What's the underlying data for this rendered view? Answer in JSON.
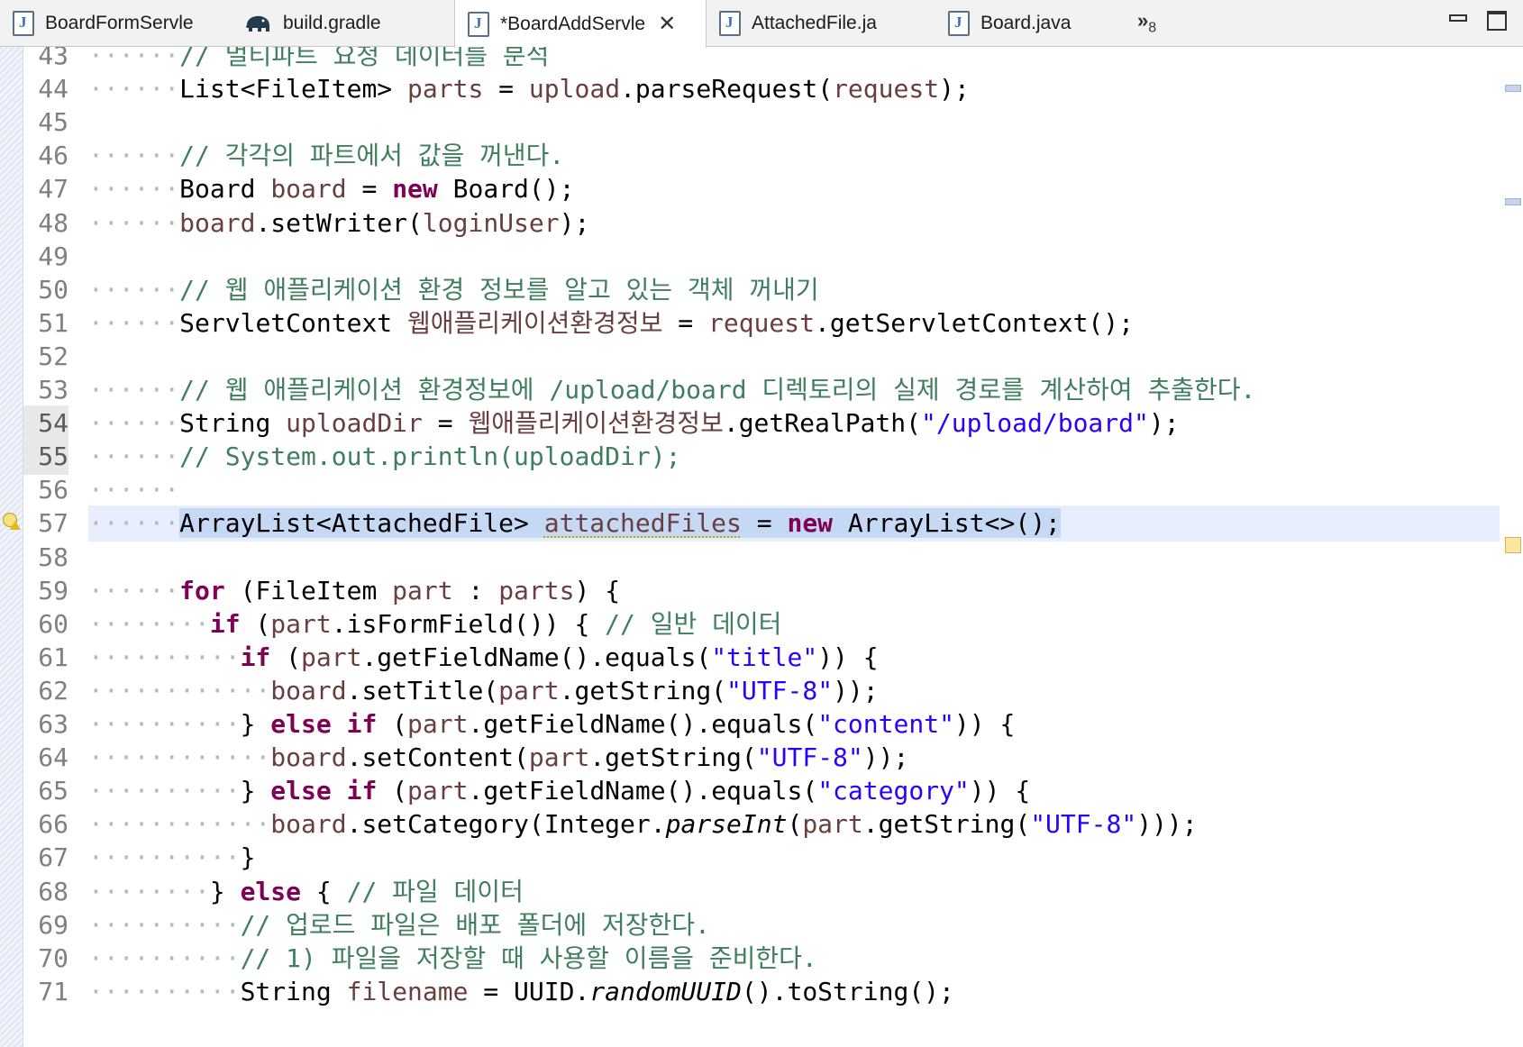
{
  "tabs": [
    {
      "label": "BoardFormServle",
      "icon": "java-file-icon",
      "active": false
    },
    {
      "label": "build.gradle",
      "icon": "gradle-elephant-icon",
      "active": false
    },
    {
      "label": "*BoardAddServle",
      "icon": "java-file-icon",
      "active": true
    },
    {
      "label": "AttachedFile.ja",
      "icon": "java-file-icon",
      "active": false
    },
    {
      "label": "Board.java",
      "icon": "java-file-icon",
      "active": false
    }
  ],
  "tabs_overflow": {
    "glyph": "»",
    "count": "8"
  },
  "code": {
    "partial_top": "// 멀티파트 요청 데이터를 분석",
    "lines": [
      {
        "n": "43",
        "tokens": [
          [
            "cm",
            "// 멀티파트 요청 데이터를 분석"
          ]
        ]
      },
      {
        "n": "44",
        "tokens": [
          [
            "",
            "List<FileItem> "
          ],
          [
            "vr",
            "parts"
          ],
          [
            "",
            " = "
          ],
          [
            "vr",
            "upload"
          ],
          [
            "",
            ".parseRequest("
          ],
          [
            "vr",
            "request"
          ],
          [
            "",
            ");"
          ]
        ]
      },
      {
        "n": "45",
        "tokens": []
      },
      {
        "n": "46",
        "tokens": [
          [
            "cm",
            "// 각각의 파트에서 값을 꺼낸다."
          ]
        ]
      },
      {
        "n": "47",
        "tokens": [
          [
            "",
            "Board "
          ],
          [
            "vr",
            "board"
          ],
          [
            "",
            " = "
          ],
          [
            "kw",
            "new"
          ],
          [
            "",
            " Board();"
          ]
        ]
      },
      {
        "n": "48",
        "tokens": [
          [
            "vr",
            "board"
          ],
          [
            "",
            ".setWriter("
          ],
          [
            "vr",
            "loginUser"
          ],
          [
            "",
            ");"
          ]
        ]
      },
      {
        "n": "49",
        "tokens": []
      },
      {
        "n": "50",
        "tokens": [
          [
            "cm",
            "// 웹 애플리케이션 환경 정보를 알고 있는 객체 꺼내기"
          ]
        ]
      },
      {
        "n": "51",
        "tokens": [
          [
            "",
            "ServletContext "
          ],
          [
            "vr",
            "웹애플리케이션환경정보"
          ],
          [
            "",
            " = "
          ],
          [
            "vr",
            "request"
          ],
          [
            "",
            ".getServletContext();"
          ]
        ]
      },
      {
        "n": "52",
        "tokens": []
      },
      {
        "n": "53",
        "tokens": [
          [
            "cm",
            "// 웹 애플리케이션 환경정보에 /upload/board 디렉토리의 실제 경로를 계산하여 추출한다."
          ]
        ]
      },
      {
        "n": "54",
        "tokens": [
          [
            "",
            "String "
          ],
          [
            "vr",
            "uploadDir"
          ],
          [
            "",
            " = "
          ],
          [
            "vr",
            "웹애플리케이션환경정보"
          ],
          [
            "",
            ".getRealPath("
          ],
          [
            "st",
            "\"/upload/board\""
          ],
          [
            "",
            ");"
          ]
        ]
      },
      {
        "n": "55",
        "tokens": [
          [
            "cm",
            "// System.out.println(uploadDir);"
          ]
        ]
      },
      {
        "n": "56",
        "tokens": []
      },
      {
        "n": "57",
        "tokens": [
          [
            "",
            "ArrayList<AttachedFile> "
          ],
          [
            "vr warnu",
            "attachedFiles"
          ],
          [
            "",
            " = "
          ],
          [
            "kw",
            "new"
          ],
          [
            "",
            " ArrayList<>();"
          ]
        ]
      },
      {
        "n": "58",
        "tokens": []
      },
      {
        "n": "59",
        "tokens": [
          [
            "kw",
            "for"
          ],
          [
            "",
            " (FileItem "
          ],
          [
            "vr",
            "part"
          ],
          [
            "",
            " : "
          ],
          [
            "vr",
            "parts"
          ],
          [
            "",
            ") {"
          ]
        ]
      },
      {
        "n": "60",
        "tokens": [
          [
            "kw",
            "if"
          ],
          [
            "",
            " ("
          ],
          [
            "vr",
            "part"
          ],
          [
            "",
            ".isFormField()) { "
          ],
          [
            "cm",
            "// 일반 데이터"
          ]
        ]
      },
      {
        "n": "61",
        "tokens": [
          [
            "kw",
            "if"
          ],
          [
            "",
            " ("
          ],
          [
            "vr",
            "part"
          ],
          [
            "",
            ".getFieldName().equals("
          ],
          [
            "st",
            "\"title\""
          ],
          [
            "",
            ")) {"
          ]
        ]
      },
      {
        "n": "62",
        "tokens": [
          [
            "vr",
            "board"
          ],
          [
            "",
            ".setTitle("
          ],
          [
            "vr",
            "part"
          ],
          [
            "",
            ".getString("
          ],
          [
            "st",
            "\"UTF-8\""
          ],
          [
            "",
            "));"
          ]
        ]
      },
      {
        "n": "63",
        "tokens": [
          [
            "",
            "} "
          ],
          [
            "kw",
            "else"
          ],
          [
            "",
            " "
          ],
          [
            "kw",
            "if"
          ],
          [
            "",
            " ("
          ],
          [
            "vr",
            "part"
          ],
          [
            "",
            ".getFieldName().equals("
          ],
          [
            "st",
            "\"content\""
          ],
          [
            "",
            ")) {"
          ]
        ]
      },
      {
        "n": "64",
        "tokens": [
          [
            "vr",
            "board"
          ],
          [
            "",
            ".setContent("
          ],
          [
            "vr",
            "part"
          ],
          [
            "",
            ".getString("
          ],
          [
            "st",
            "\"UTF-8\""
          ],
          [
            "",
            "));"
          ]
        ]
      },
      {
        "n": "65",
        "tokens": [
          [
            "",
            "} "
          ],
          [
            "kw",
            "else"
          ],
          [
            "",
            " "
          ],
          [
            "kw",
            "if"
          ],
          [
            "",
            " ("
          ],
          [
            "vr",
            "part"
          ],
          [
            "",
            ".getFieldName().equals("
          ],
          [
            "st",
            "\"category\""
          ],
          [
            "",
            ")) {"
          ]
        ]
      },
      {
        "n": "66",
        "tokens": [
          [
            "vr",
            "board"
          ],
          [
            "",
            ".setCategory(Integer."
          ],
          [
            "it",
            "parseInt"
          ],
          [
            "",
            "("
          ],
          [
            "vr",
            "part"
          ],
          [
            "",
            ".getString("
          ],
          [
            "st",
            "\"UTF-8\""
          ],
          [
            "",
            ")));"
          ]
        ]
      },
      {
        "n": "67",
        "tokens": [
          [
            "",
            "}"
          ]
        ]
      },
      {
        "n": "68",
        "tokens": [
          [
            "",
            "} "
          ],
          [
            "kw",
            "else"
          ],
          [
            "",
            " { "
          ],
          [
            "cm",
            "// 파일 데이터"
          ]
        ]
      },
      {
        "n": "69",
        "tokens": [
          [
            "cm",
            "// 업로드 파일은 배포 폴더에 저장한다."
          ]
        ]
      },
      {
        "n": "70",
        "tokens": [
          [
            "cm",
            "// 1) 파일을 저장할 때 사용할 이름을 준비한다."
          ]
        ]
      },
      {
        "n": "71",
        "tokens": [
          [
            "",
            "String "
          ],
          [
            "vr",
            "filename"
          ],
          [
            "",
            " = UUID."
          ],
          [
            "it",
            "randomUUID"
          ],
          [
            "",
            "().toString();"
          ]
        ]
      }
    ]
  },
  "colors": {
    "keyword": "#7f0055",
    "variable": "#6a3e3e",
    "comment": "#3f7f5f",
    "string": "#2a00ff",
    "current_line": "#e8eefb",
    "selection": "#c5d9f5"
  }
}
